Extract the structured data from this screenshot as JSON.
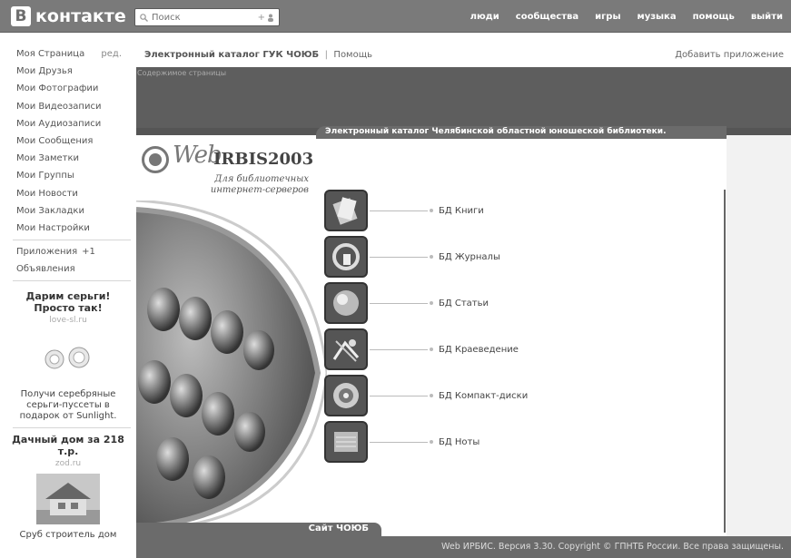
{
  "header": {
    "logo_letter": "В",
    "logo_text": "контакте",
    "search_placeholder": "Поиск",
    "search_plus": "+",
    "nav": [
      "люди",
      "сообщества",
      "игры",
      "музыка",
      "помощь",
      "выйти"
    ]
  },
  "sidebar": {
    "items": [
      {
        "label": "Моя Страница",
        "extra": "ред."
      },
      {
        "label": "Мои Друзья"
      },
      {
        "label": "Мои Фотографии"
      },
      {
        "label": "Мои Видеозаписи"
      },
      {
        "label": "Мои Аудиозаписи"
      },
      {
        "label": "Мои Сообщения"
      },
      {
        "label": "Мои Заметки"
      },
      {
        "label": "Мои Группы"
      },
      {
        "label": "Мои Новости"
      },
      {
        "label": "Мои Закладки"
      },
      {
        "label": "Мои Настройки"
      }
    ],
    "apps": {
      "label": "Приложения",
      "count": "+1"
    },
    "ads_label": "Объявления",
    "ad1": {
      "title": "Дарим серьги! Просто так!",
      "src": "love-sl.ru",
      "text": "Получи серебряные серьги-пуссеты в подарок от Sunlight."
    },
    "ad2": {
      "title": "Дачный дом за 218 т.р.",
      "src": "zod.ru",
      "text": "Сруб строитель дом"
    }
  },
  "app": {
    "title": "Электронный каталог ГУК ЧОЮБ",
    "separator": "|",
    "help": "Помощь",
    "add_app": "Добавить приложение",
    "content_label": "Содержимое страницы",
    "banner": "Электронный каталог Челябинской областной юношеской библиотеки.",
    "web_text": "Web",
    "irbis_text": "IRBIS2003",
    "tagline": "Для библиотечных интернет-серверов",
    "databases": [
      {
        "label": "БД Книги",
        "icon": "books-icon"
      },
      {
        "label": "БД Журналы",
        "icon": "magazines-icon"
      },
      {
        "label": "БД Статьи",
        "icon": "articles-icon"
      },
      {
        "label": "БД Краеведение",
        "icon": "local-history-icon"
      },
      {
        "label": "БД Компакт-диски",
        "icon": "cd-icon"
      },
      {
        "label": "БД Ноты",
        "icon": "sheet-music-icon"
      }
    ],
    "site_tab": "Сайт ЧОЮБ",
    "footer": "Web ИРБИС. Версия 3.30. Copyright © ГПНТБ России. Все права защищены."
  }
}
